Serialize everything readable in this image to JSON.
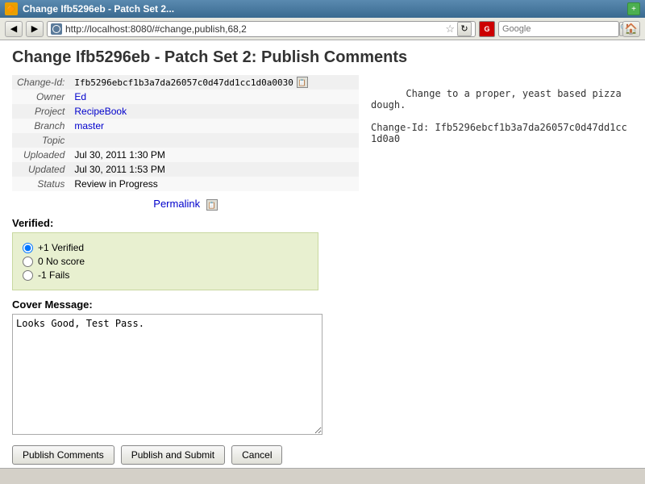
{
  "window": {
    "title": "Change Ifb5296eb - Patch Set 2...",
    "icon": "🔶"
  },
  "browser": {
    "back_btn": "◀",
    "forward_btn": "▶",
    "address": "http://localhost:8080/#change,publish,68,2",
    "star": "☆",
    "reload": "↻",
    "search_placeholder": "Google",
    "home": "🏠"
  },
  "page": {
    "title": "Change Ifb5296eb - Patch Set 2: Publish Comments"
  },
  "change_info": {
    "change_id_label": "Change-Id:",
    "change_id_value": "Ifb5296ebcf1b3a7da26057c0d47dd1cc1d0a0030",
    "owner_label": "Owner",
    "owner_value": "Ed",
    "project_label": "Project",
    "project_value": "RecipeBook",
    "branch_label": "Branch",
    "branch_value": "master",
    "topic_label": "Topic",
    "topic_value": "",
    "uploaded_label": "Uploaded",
    "uploaded_value": "Jul 30, 2011 1:30 PM",
    "updated_label": "Updated",
    "updated_value": "Jul 30, 2011 1:53 PM",
    "status_label": "Status",
    "status_value": "Review in Progress"
  },
  "permalink": {
    "label": "Permalink"
  },
  "right_panel": {
    "description": "Change to a proper, yeast based pizza dough.\n\nChange-Id: Ifb5296ebcf1b3a7da26057c0d47dd1cc1d0a0"
  },
  "verified": {
    "label": "Verified:",
    "options": [
      {
        "value": "+1",
        "label": "+1 Verified",
        "selected": true
      },
      {
        "value": "0",
        "label": "0 No score",
        "selected": false
      },
      {
        "value": "-1",
        "label": "-1 Fails",
        "selected": false
      }
    ]
  },
  "cover_message": {
    "label": "Cover Message:",
    "value": "Looks Good, Test Pass."
  },
  "buttons": {
    "publish_comments": "Publish Comments",
    "publish_and_submit": "Publish and Submit",
    "cancel": "Cancel"
  },
  "status_bar": {
    "text": ""
  }
}
